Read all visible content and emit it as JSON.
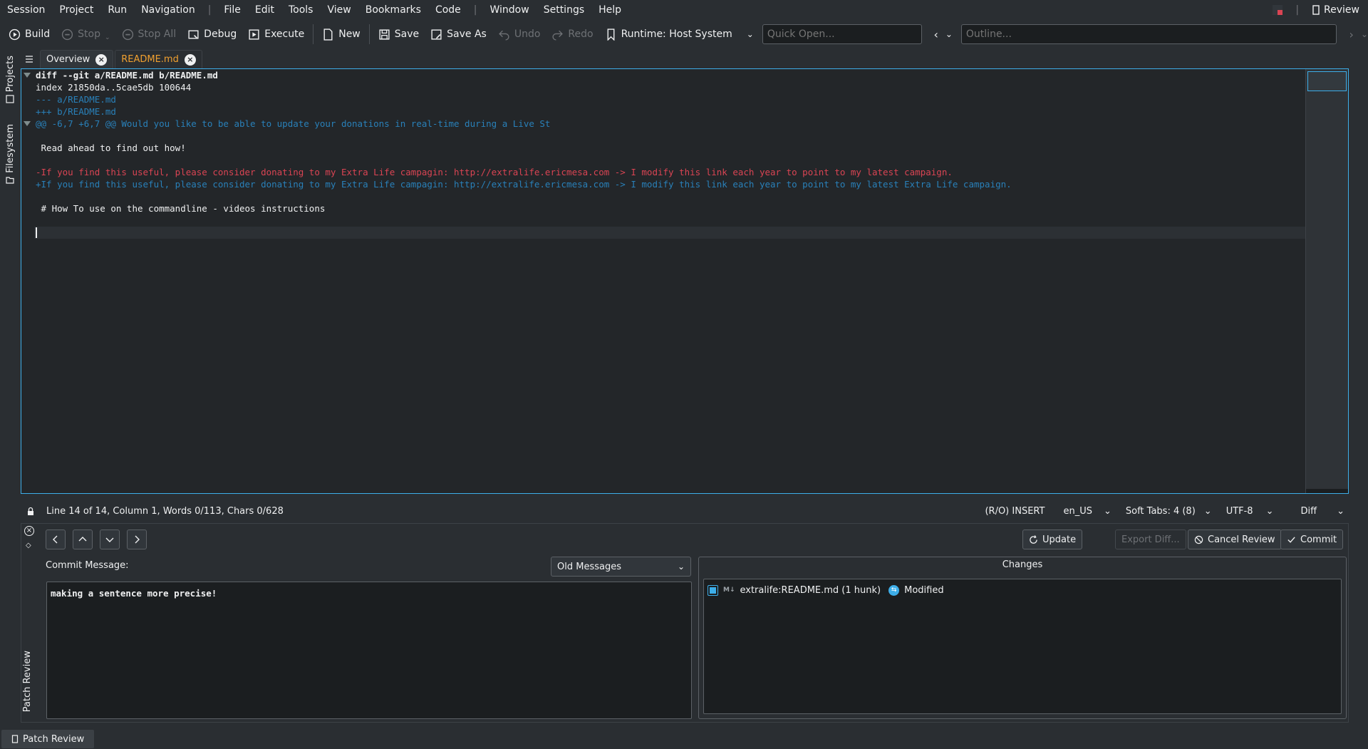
{
  "menu": {
    "items_left": [
      "Session",
      "Project",
      "Run",
      "Navigation"
    ],
    "items_mid": [
      "File",
      "Edit",
      "Tools",
      "View",
      "Bookmarks",
      "Code"
    ],
    "items_right": [
      "Window",
      "Settings",
      "Help"
    ],
    "review_label": "Review"
  },
  "toolbar": {
    "build": "Build",
    "stop": "Stop",
    "stop_all": "Stop All",
    "debug": "Debug",
    "execute": "Execute",
    "new": "New",
    "save": "Save",
    "save_as": "Save As",
    "undo": "Undo",
    "redo": "Redo",
    "runtime": "Runtime: Host System",
    "quick_open_placeholder": "Quick Open...",
    "outline_placeholder": "Outline..."
  },
  "left_dock": {
    "projects": "Projects",
    "filesystem": "Filesystem"
  },
  "tabs": [
    {
      "label": "Overview",
      "active": true
    },
    {
      "label": "README.md",
      "active": false
    }
  ],
  "editor": {
    "lines": [
      {
        "text": "diff --git a/README.md b/README.md",
        "style": "bold"
      },
      {
        "text": "index 21850da..5cae5db 100644",
        "style": "ctx"
      },
      {
        "text": "--- a/README.md",
        "style": "blue"
      },
      {
        "text": "+++ b/README.md",
        "style": "blue"
      },
      {
        "text": "@@ -6,7 +6,7 @@ Would you like to be able to update your donations in real-time during a Live St",
        "style": "blue"
      },
      {
        "text": "",
        "style": "ctx"
      },
      {
        "text": " Read ahead to find out how!",
        "style": "ctx"
      },
      {
        "text": "",
        "style": "ctx"
      },
      {
        "text": "-If you find this useful, please consider donating to my Extra Life campagin: http://extralife.ericmesa.com -> I modify this link each year to point to my latest campaign.",
        "style": "red"
      },
      {
        "text": "+If you find this useful, please consider donating to my Extra Life campagin: http://extralife.ericmesa.com -> I modify this link each year to point to my latest Extra Life campaign.",
        "style": "blue"
      },
      {
        "text": "",
        "style": "ctx"
      },
      {
        "text": " # How To use on the commandline - videos instructions",
        "style": "ctx"
      },
      {
        "text": "",
        "style": "ctx"
      },
      {
        "text": "",
        "style": "cur"
      }
    ]
  },
  "status": {
    "position": "Line 14 of 14, Column 1, Words 0/113, Chars 0/628",
    "mode": "(R/O) INSERT",
    "language": "en_US",
    "tabs": "Soft Tabs: 4 (8)",
    "encoding": "UTF-8",
    "syntax": "Diff"
  },
  "review": {
    "update": "Update",
    "export_diff": "Export Diff...",
    "cancel_review": "Cancel Review",
    "commit": "Commit",
    "commit_message_label": "Commit Message:",
    "old_messages": "Old Messages",
    "commit_message": "making a sentence more precise!",
    "changes_title": "Changes",
    "change_file": "extralife:README.md (1 hunk)",
    "change_file_type": "M↓",
    "change_status": "Modified",
    "panel_title": "Patch Review"
  },
  "bottom": {
    "patch_review": "Patch Review"
  },
  "colors": {
    "accent": "#3daee9",
    "removed": "#da4453",
    "added": "#2980b9",
    "tab_modified": "#f0a030"
  }
}
